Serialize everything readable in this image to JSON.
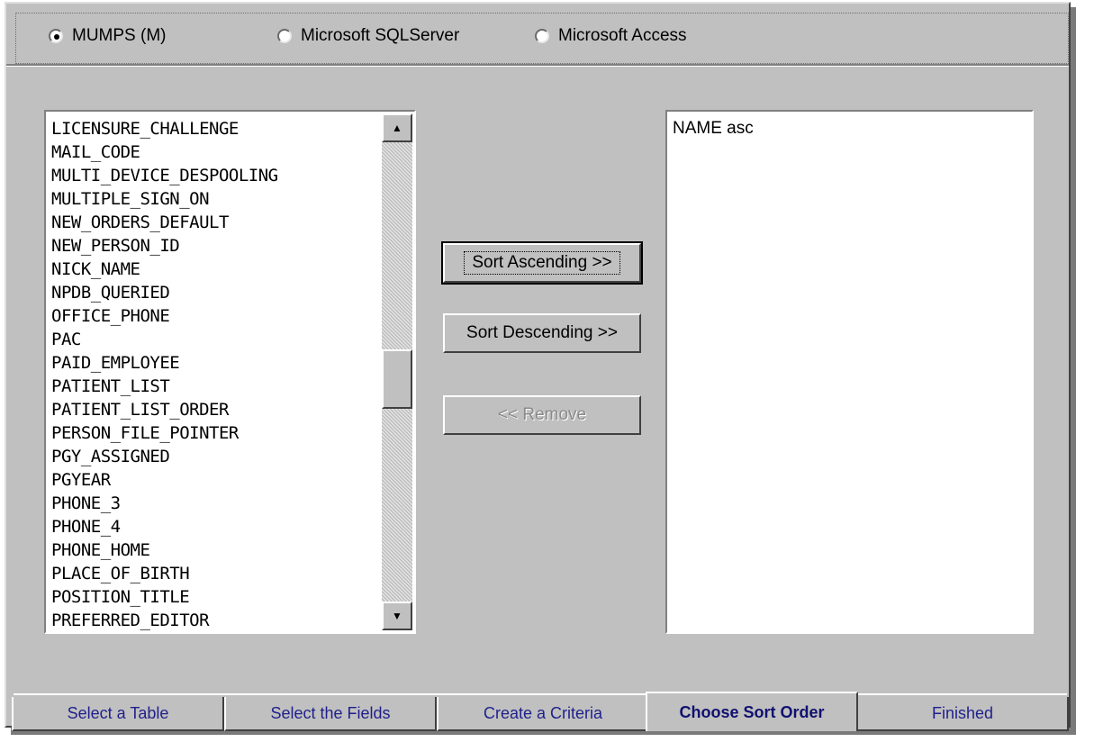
{
  "radio_options": [
    {
      "label": "MUMPS (M)",
      "selected": true
    },
    {
      "label": "Microsoft SQLServer",
      "selected": false
    },
    {
      "label": "Microsoft Access",
      "selected": false
    }
  ],
  "field_list": [
    "LICENSURE_CHALLENGE",
    "MAIL_CODE",
    "MULTI_DEVICE_DESPOOLING",
    "MULTIPLE_SIGN_ON",
    "NEW_ORDERS_DEFAULT",
    "NEW_PERSON_ID",
    "NICK_NAME",
    "NPDB_QUERIED",
    "OFFICE_PHONE",
    "PAC",
    "PAID_EMPLOYEE",
    "PATIENT_LIST",
    "PATIENT_LIST_ORDER",
    "PERSON_FILE_POINTER",
    "PGY_ASSIGNED",
    "PGYEAR",
    "PHONE_3",
    "PHONE_4",
    "PHONE_HOME",
    "PLACE_OF_BIRTH",
    "POSITION_TITLE",
    "PREFERRED_EDITOR"
  ],
  "scrollbar": {
    "up_icon": "arrow-up-icon",
    "down_icon": "arrow-down-icon"
  },
  "buttons": {
    "sort_ascending": "Sort Ascending >>",
    "sort_descending": "Sort Descending >>",
    "remove": "<< Remove"
  },
  "sort_order": [
    "NAME asc"
  ],
  "tabs": [
    {
      "label": "Select a Table",
      "active": false
    },
    {
      "label": "Select the Fields",
      "active": false
    },
    {
      "label": "Create a Criteria",
      "active": false
    },
    {
      "label": "Choose Sort Order",
      "active": true
    },
    {
      "label": "Finished",
      "active": false
    }
  ],
  "colors": {
    "tab_text": "#1f1f8c",
    "face": "#c0c0c0"
  }
}
